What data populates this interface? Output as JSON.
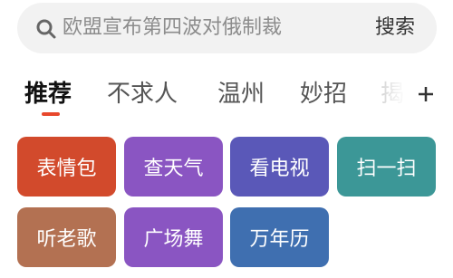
{
  "search": {
    "placeholder": "欧盟宣布第四波对俄制裁",
    "button_label": "搜索",
    "icon": "search-icon"
  },
  "tabs": [
    {
      "label": "推荐",
      "active": true
    },
    {
      "label": "不求人",
      "active": false
    },
    {
      "label": "温州",
      "active": false
    },
    {
      "label": "妙招",
      "active": false
    },
    {
      "label": "揭",
      "active": false
    }
  ],
  "add_tab_icon": "plus-icon",
  "accent_color": "#e8472c",
  "shortcuts": [
    {
      "label": "表情包",
      "color": "#d24a2c"
    },
    {
      "label": "查天气",
      "color": "#8a55c2"
    },
    {
      "label": "看电视",
      "color": "#5a58b8"
    },
    {
      "label": "扫一扫",
      "color": "#3c9797"
    },
    {
      "label": "听老歌",
      "color": "#b37152"
    },
    {
      "label": "广场舞",
      "color": "#8a55c2"
    },
    {
      "label": "万年历",
      "color": "#3f6fb0"
    }
  ]
}
